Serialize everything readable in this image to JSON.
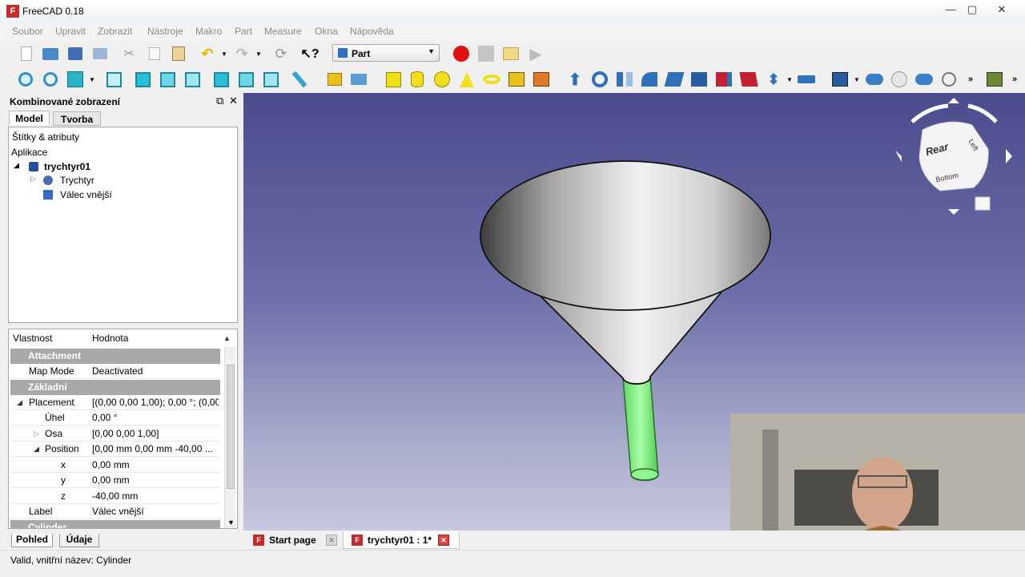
{
  "window": {
    "title": "FreeCAD 0.18",
    "app_icon": "freecad-icon"
  },
  "menubar": [
    "Soubor",
    "Upravit",
    "Zobrazit",
    "Nástroje",
    "Makro",
    "Part",
    "Measure",
    "Okna",
    "Nápověda"
  ],
  "workbench": {
    "selected": "Part"
  },
  "panel": {
    "title": "Kombinované zobrazení",
    "tabs": [
      "Model",
      "Tvorba"
    ]
  },
  "tree": {
    "header": "Štítky & atributy",
    "section": "Aplikace",
    "items": [
      {
        "label": "trychtyr01",
        "icon": "document-icon"
      },
      {
        "label": "Trychtyr",
        "icon": "funnel-shape-icon"
      },
      {
        "label": "Válec vnější",
        "icon": "cylinder-icon"
      }
    ]
  },
  "properties": {
    "columns": [
      "Vlastnost",
      "Hodnota"
    ],
    "rows": [
      {
        "type": "group",
        "name": "Attachment"
      },
      {
        "type": "prop",
        "name": "Map Mode",
        "value": "Deactivated"
      },
      {
        "type": "group",
        "name": "Základní"
      },
      {
        "type": "prop",
        "name": "Placement",
        "value": "[(0,00 0,00 1,00); 0,00 °; (0,00..."
      },
      {
        "type": "prop",
        "name": "Úhel",
        "value": "0,00 °"
      },
      {
        "type": "prop",
        "name": "Osa",
        "value": "[0,00 0,00 1,00]"
      },
      {
        "type": "prop",
        "name": "Position",
        "value": "[0,00 mm  0,00 mm  -40,00 ..."
      },
      {
        "type": "prop",
        "name": "x",
        "value": "0,00 mm"
      },
      {
        "type": "prop",
        "name": "y",
        "value": "0,00 mm"
      },
      {
        "type": "prop",
        "name": "z",
        "value": "-40,00 mm"
      },
      {
        "type": "prop",
        "name": "Label",
        "value": "Válec vnější"
      },
      {
        "type": "group",
        "name": "Cylinder"
      }
    ]
  },
  "bottom_tabs": [
    "Pohled",
    "Údaje"
  ],
  "doc_tabs": [
    {
      "label": "Start page",
      "icon": "freecad-icon"
    },
    {
      "label": "trychtyr01 : 1*",
      "icon": "freecad-icon"
    }
  ],
  "status": {
    "text": "Valid, vnitřní název: Cylinder"
  },
  "navcube": {
    "faces": [
      "Rear",
      "Left",
      "Bottom"
    ]
  },
  "colors": {
    "selection": "#7dea7d",
    "record": "#e01010",
    "viewport_top": "#4a4c8c",
    "viewport_bottom": "#c6c7dc"
  }
}
